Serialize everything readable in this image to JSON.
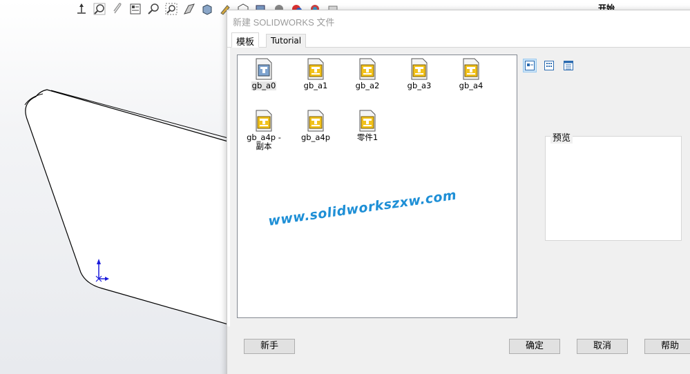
{
  "cad": {
    "task_pane_label": "开始",
    "toolbar_icons": [
      "normal-to-icon",
      "zoom-to-fit-icon",
      "attach-icon",
      "view-table-icon",
      "zoom-area-icon",
      "zoom-selection-icon",
      "section-view-icon",
      "shaded-display-icon",
      "appearance-icon",
      "scene-icon"
    ]
  },
  "dialog": {
    "title": "新建 SOLIDWORKS 文件",
    "tabs": [
      {
        "label": "模板",
        "active": true
      },
      {
        "label": "Tutorial",
        "active": false
      }
    ],
    "templates": [
      {
        "label": "gb_a0",
        "selected": true
      },
      {
        "label": "gb_a1",
        "selected": false
      },
      {
        "label": "gb_a2",
        "selected": false
      },
      {
        "label": "gb_a3",
        "selected": false
      },
      {
        "label": "gb_a4",
        "selected": false
      },
      {
        "label": "gb_a4p - 副本",
        "selected": false
      },
      {
        "label": "gb_a4p",
        "selected": false
      },
      {
        "label": "零件1",
        "selected": false
      }
    ],
    "view_modes": [
      "large-icons-icon",
      "list-icon",
      "details-icon"
    ],
    "preview_label": "预览",
    "watermark": "www.solidworkszxw.com",
    "buttons": {
      "novice": "新手",
      "ok": "确定",
      "cancel": "取消",
      "help": "帮助"
    }
  },
  "colors": {
    "dialog_bg": "#f0f0f0",
    "selection": "#cce4f7",
    "watermark": "#1e8fd6",
    "drawing_icon": "#e8b400"
  }
}
